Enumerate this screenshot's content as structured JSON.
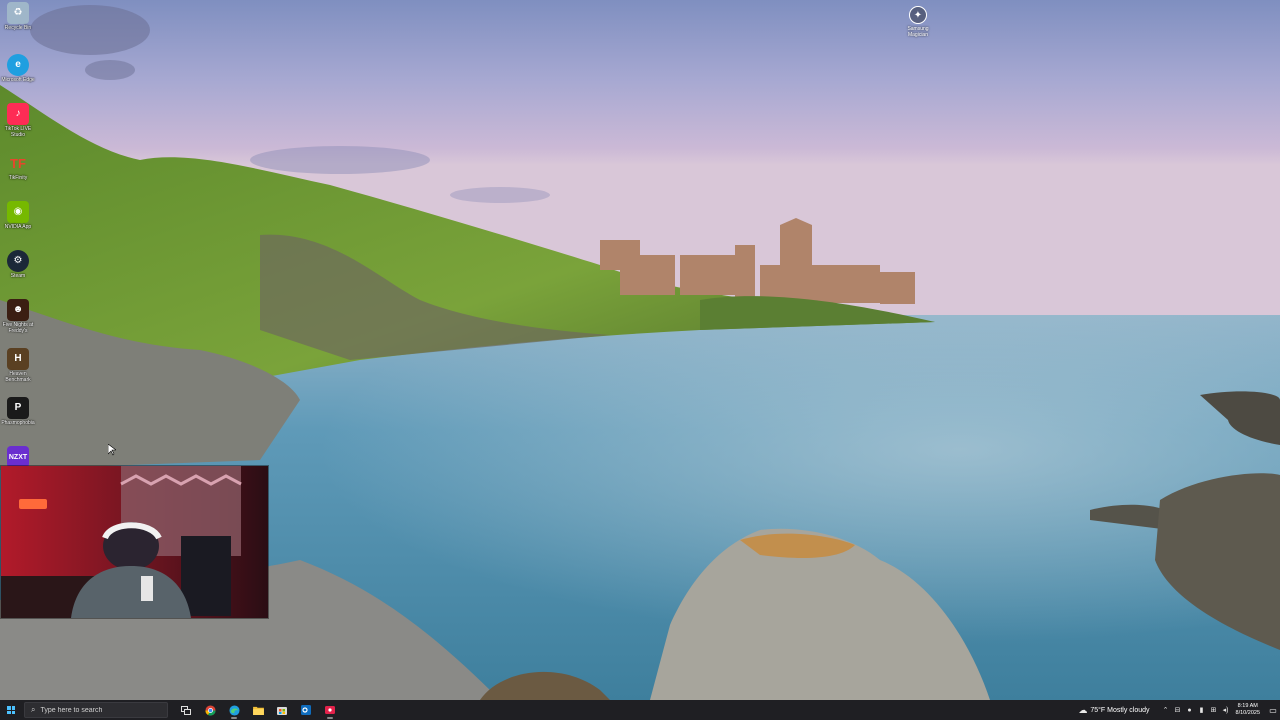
{
  "desktop": {
    "icons": [
      {
        "label": "Recycle Bin",
        "icon": "recycle-bin-icon",
        "color": "#9fb6c9"
      },
      {
        "label": "Microsoft Edge",
        "icon": "edge-icon",
        "color": "#1f9fe0"
      },
      {
        "label": "TikTok LIVE Studio",
        "icon": "tiktok-icon",
        "color": "#fe2c55"
      },
      {
        "label": "TikFinity",
        "icon": "tikfinity-icon",
        "color": "#e8452c"
      },
      {
        "label": "NVIDIA App",
        "icon": "nvidia-icon",
        "color": "#76b900"
      },
      {
        "label": "Steam",
        "icon": "steam-icon",
        "color": "#1b2838"
      },
      {
        "label": "Five Nights at Freddy's",
        "icon": "fnaf-icon",
        "color": "#3b1e12"
      },
      {
        "label": "Heaven Benchmark",
        "icon": "heaven-icon",
        "color": "#5a4022"
      },
      {
        "label": "Phasmophobia",
        "icon": "phasmophobia-icon",
        "color": "#1a1a1a"
      },
      {
        "label": "NZXT",
        "icon": "nzxt-icon",
        "color": "#6a2ecf"
      }
    ],
    "top_right_icon": {
      "label": "Samsung Magician",
      "icon": "samsung-magician-icon"
    }
  },
  "taskbar": {
    "search_placeholder": "Type here to search",
    "pinned": [
      {
        "name": "task-view",
        "icon": "task-view-icon"
      },
      {
        "name": "chrome",
        "icon": "chrome-icon"
      },
      {
        "name": "edge",
        "icon": "edge-icon"
      },
      {
        "name": "file-explorer",
        "icon": "folder-icon"
      },
      {
        "name": "microsoft-store",
        "icon": "store-icon"
      },
      {
        "name": "outlook",
        "icon": "outlook-icon"
      },
      {
        "name": "streaming-app",
        "icon": "record-icon"
      }
    ],
    "weather": {
      "text": "75°F  Mostly cloudy",
      "icon": "cloud-icon"
    },
    "clock": {
      "time": "8:19 AM",
      "date": "8/10/2025"
    }
  },
  "colors": {
    "taskbar": "#1f1f23",
    "accent": "#4cc2ff"
  }
}
